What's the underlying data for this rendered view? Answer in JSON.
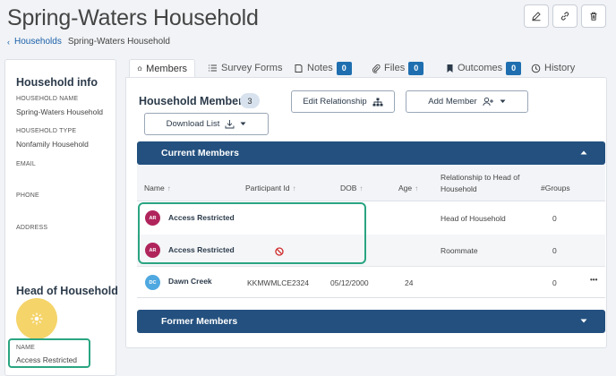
{
  "page": {
    "title": "Spring-Waters Household",
    "breadcrumb": {
      "link": "Households",
      "current": "Spring-Waters Household"
    },
    "toolbar_icons": [
      "edit-icon",
      "link-icon",
      "trash-icon"
    ]
  },
  "household_info": {
    "heading": "Household info",
    "fields": {
      "name": {
        "label": "HOUSEHOLD NAME",
        "value": "Spring-Waters Household"
      },
      "type": {
        "label": "HOUSEHOLD TYPE",
        "value": "Nonfamily Household"
      },
      "email": {
        "label": "EMAIL",
        "value": ""
      },
      "phone": {
        "label": "PHONE",
        "value": ""
      },
      "address": {
        "label": "ADDRESS",
        "value": ""
      }
    },
    "head": {
      "heading": "Head of Household",
      "name_label": "NAME",
      "name_value": "Access Restricted"
    }
  },
  "tabs": [
    {
      "label": "Members",
      "badge": "",
      "icon": "home-icon",
      "active": true
    },
    {
      "label": "Survey Forms",
      "badge": "",
      "icon": "list-icon"
    },
    {
      "label": "Notes",
      "badge": "0",
      "icon": "note-icon"
    },
    {
      "label": "Files",
      "badge": "0",
      "icon": "paperclip-icon"
    },
    {
      "label": "Outcomes",
      "badge": "0",
      "icon": "bookmark-icon"
    },
    {
      "label": "History",
      "badge": "",
      "icon": "clock-icon"
    }
  ],
  "members": {
    "title": "Household Members",
    "count": "3",
    "edit_relationship": "Edit Relationship",
    "add_member": "Add Member",
    "download_list": "Download List",
    "current_section": "Current Members",
    "former_section": "Former Members",
    "columns": {
      "name": "Name",
      "participant_id": "Participant Id",
      "dob": "DOB",
      "age": "Age",
      "relationship": "Relationship to Head of Household",
      "groups": "#Groups"
    },
    "rows": [
      {
        "initials": "AR",
        "name": "Access Restricted",
        "participant_id": "",
        "dob": "",
        "age": "",
        "relationship": "Head of Household",
        "groups": "0",
        "avatar_color": "#b0245c"
      },
      {
        "initials": "AR",
        "name": "Access Restricted",
        "participant_id": "",
        "dob": "",
        "age": "",
        "relationship": "Roommate",
        "groups": "0",
        "avatar_color": "#b0245c",
        "restricted_icon": "no-entry-icon"
      },
      {
        "initials": "DC",
        "name": "Dawn Creek",
        "participant_id": "KKMWMLCE2324",
        "dob": "05/12/2000",
        "age": "24",
        "relationship": "",
        "groups": "0",
        "avatar_color": "#4fa8e0",
        "more": "•••"
      }
    ]
  },
  "colors": {
    "accent": "#23507f",
    "badge": "#1f6fb0",
    "highlight": "#2aa582",
    "avatar_sun": "#f5d46a"
  }
}
